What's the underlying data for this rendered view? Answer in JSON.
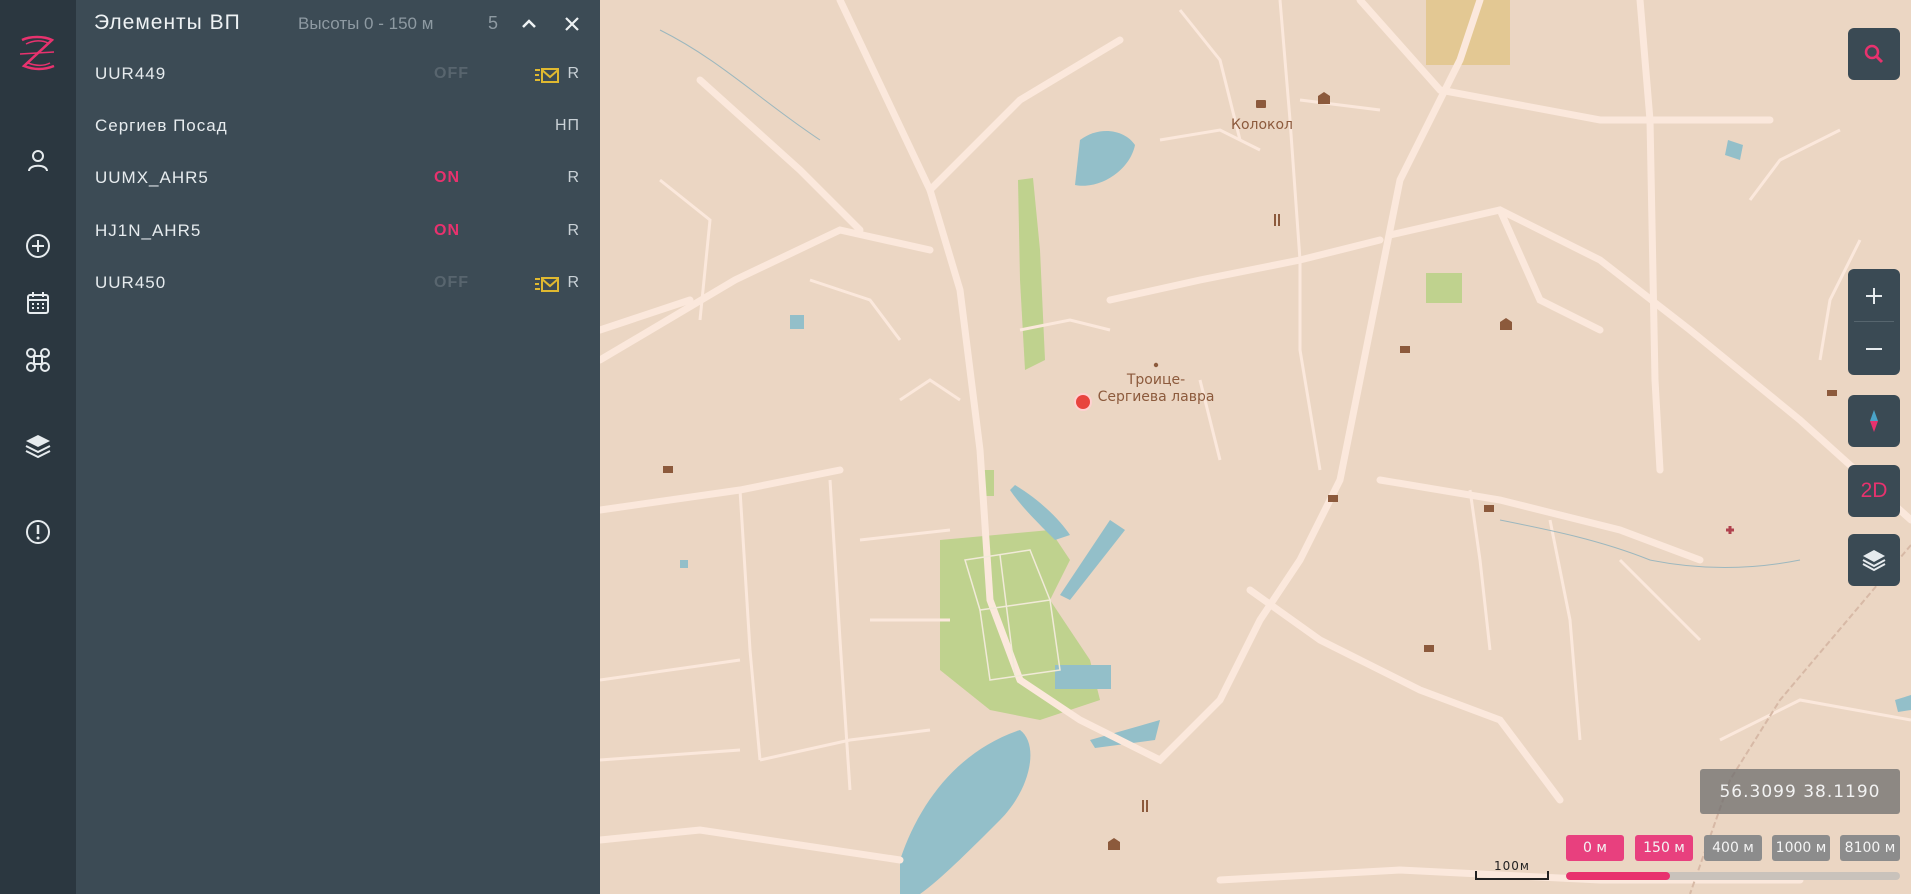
{
  "rail": {
    "items": [
      {
        "icon": "user-icon"
      },
      {
        "icon": "add-circle-icon"
      },
      {
        "icon": "calendar-icon"
      },
      {
        "icon": "drone-icon"
      },
      {
        "icon": "layers-icon"
      },
      {
        "icon": "alert-icon"
      }
    ],
    "brand_color": "#e8326e"
  },
  "panel": {
    "title": "Элементы ВП",
    "height_range": "Высоты 0 - 150 м",
    "count": "5",
    "rows": [
      {
        "name": "UUR449",
        "status": "OFF",
        "status_state": "off",
        "has_mail_icon": true,
        "code": "R"
      },
      {
        "name": "Сергиев Посад",
        "status": "",
        "status_state": "none",
        "has_mail_icon": false,
        "code": "НП"
      },
      {
        "name": "UUMX_AHR5",
        "status": "ON",
        "status_state": "on",
        "has_mail_icon": false,
        "code": "R"
      },
      {
        "name": "HJ1N_AHR5",
        "status": "ON",
        "status_state": "on",
        "has_mail_icon": false,
        "code": "R"
      },
      {
        "name": "UUR450",
        "status": "OFF",
        "status_state": "off",
        "has_mail_icon": true,
        "code": "R"
      }
    ]
  },
  "map": {
    "labels": {
      "kolokol": "Колокол",
      "lavra_line1": "Троице-",
      "lavra_line2": "Сергиева лавра"
    },
    "coordinates": "56.3099 38.1190",
    "view_mode": "2D",
    "scale_label": "100м",
    "altitude_buttons": [
      {
        "label": "0 м",
        "active": true
      },
      {
        "label": "150 м",
        "active": true
      },
      {
        "label": "400 м",
        "active": false
      },
      {
        "label": "1000 м",
        "active": false
      },
      {
        "label": "8100 м",
        "active": false
      }
    ],
    "altitude_fill_fraction": 0.31,
    "colors": {
      "land": "#ebd6c3",
      "road": "#fbe8dc",
      "water": "#93bfc9",
      "park": "#bfd28e",
      "accent": "#e8326e"
    }
  }
}
